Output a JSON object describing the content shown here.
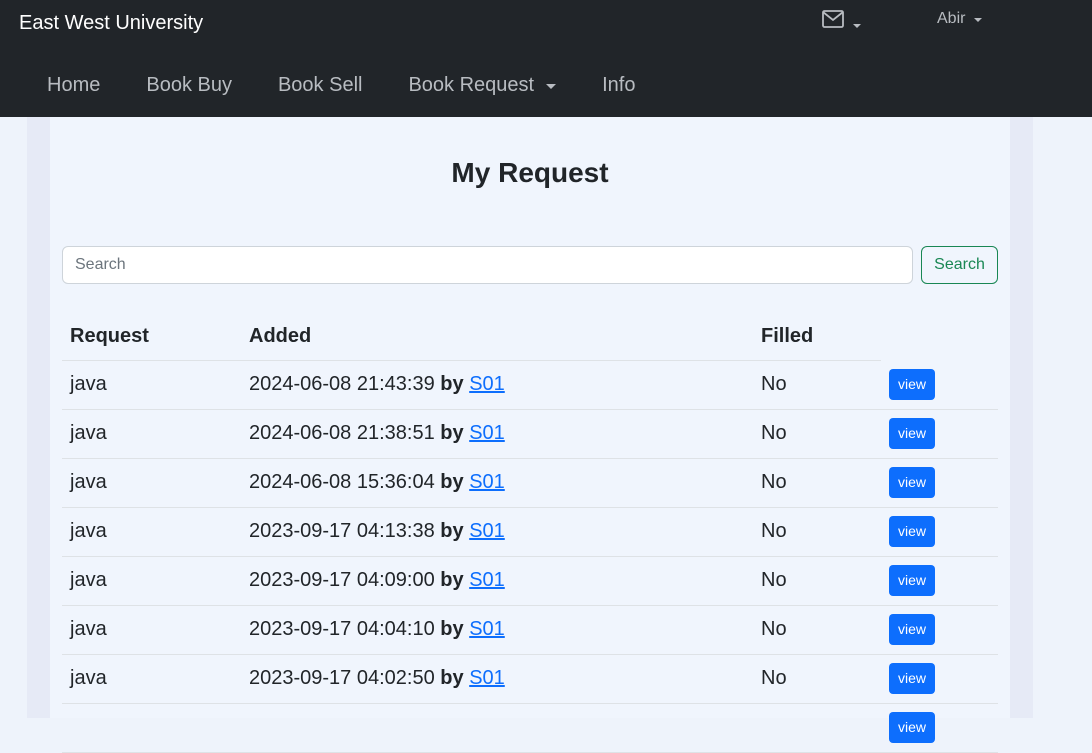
{
  "navbar": {
    "brand": "East West University",
    "mail_icon": "mail-icon",
    "user": "Abir",
    "menu": [
      {
        "label": "Home",
        "has_dropdown": false
      },
      {
        "label": "Book Buy",
        "has_dropdown": false
      },
      {
        "label": "Book Sell",
        "has_dropdown": false
      },
      {
        "label": "Book Request",
        "has_dropdown": true
      },
      {
        "label": "Info",
        "has_dropdown": false
      }
    ]
  },
  "main": {
    "title": "My Request",
    "search": {
      "placeholder": "Search",
      "value": "",
      "button_label": "Search"
    },
    "table": {
      "headers": [
        "Request",
        "Added",
        "Filled",
        ""
      ],
      "by_label": "by",
      "view_label": "view",
      "rows": [
        {
          "request": "java",
          "added": "2024-06-08 21:43:39",
          "user": "S01",
          "filled": "No"
        },
        {
          "request": "java",
          "added": "2024-06-08 21:38:51",
          "user": "S01",
          "filled": "No"
        },
        {
          "request": "java",
          "added": "2024-06-08 15:36:04",
          "user": "S01",
          "filled": "No"
        },
        {
          "request": "java",
          "added": "2023-09-17 04:13:38",
          "user": "S01",
          "filled": "No"
        },
        {
          "request": "java",
          "added": "2023-09-17 04:09:00",
          "user": "S01",
          "filled": "No"
        },
        {
          "request": "java",
          "added": "2023-09-17 04:04:10",
          "user": "S01",
          "filled": "No"
        },
        {
          "request": "java",
          "added": "2023-09-17 04:02:50",
          "user": "S01",
          "filled": "No"
        },
        {
          "request": "",
          "added": "",
          "user": "",
          "filled": ""
        }
      ]
    }
  },
  "colors": {
    "navbar_bg": "#212529",
    "primary": "#0d6efd",
    "success": "#198754",
    "page_bg": "#eef3fb"
  }
}
